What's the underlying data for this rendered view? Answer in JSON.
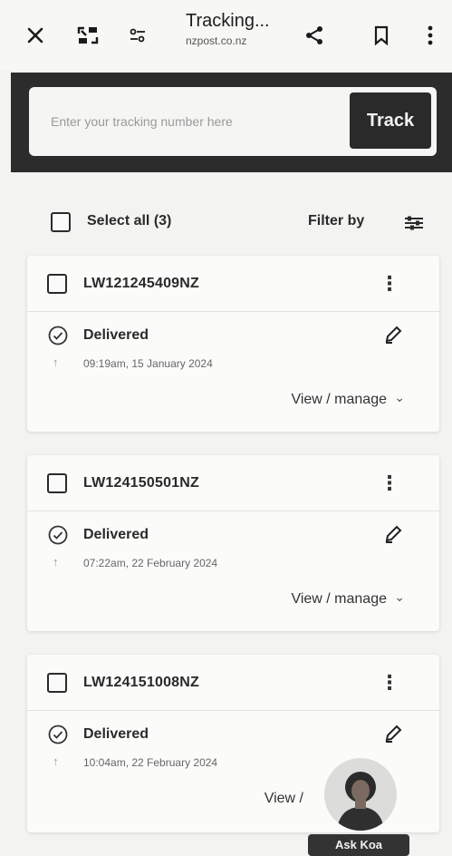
{
  "browser": {
    "title": "Tracking...",
    "url": "nzpost.co.nz",
    "icons": [
      "close-icon",
      "tabs-icon",
      "tune-icon",
      "share-icon",
      "bookmark-icon",
      "more-vert-icon"
    ]
  },
  "tracking": {
    "placeholder": "Enter your tracking number here",
    "button_label": "Track"
  },
  "list_controls": {
    "select_all_label": "Select all (3)",
    "filter_label": "Filter by"
  },
  "parcels": [
    {
      "id": "LW121245409NZ",
      "status": "Delivered",
      "timestamp": "09:19am, 15 January 2024",
      "action_label": "View / manage"
    },
    {
      "id": "LW124150501NZ",
      "status": "Delivered",
      "timestamp": "07:22am, 22 February 2024",
      "action_label": "View / manage"
    },
    {
      "id": "LW124151008NZ",
      "status": "Delivered",
      "timestamp": "10:04am, 22 February 2024",
      "action_label": "View /"
    }
  ],
  "assistant": {
    "label": "Ask Koa"
  },
  "colors": {
    "dark_band": "#2c2c2c",
    "track_button": "#2a2a2a",
    "page_bg": "#f3f3f1"
  }
}
